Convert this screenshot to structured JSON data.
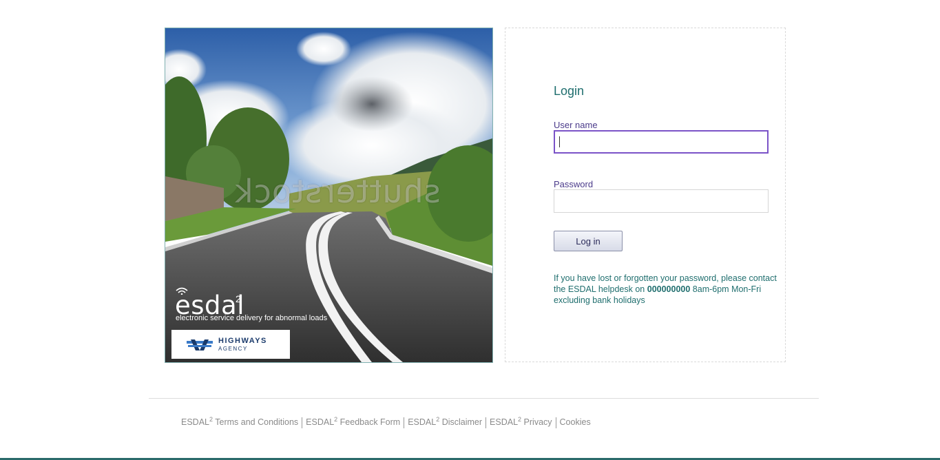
{
  "hero": {
    "watermark": "shutterstock",
    "brand_name": "esdal",
    "brand_sup": "2",
    "brand_tagline": "electronic service delivery for abnormal loads",
    "agency_name": "HIGHWAYS",
    "agency_sub": "AGENCY"
  },
  "login": {
    "title": "Login",
    "username_label": "User name",
    "username_value": "",
    "password_label": "Password",
    "password_value": "",
    "button_label": "Log in",
    "help_prefix": "If you have lost or forgotten your password, please contact the ESDAL helpdesk on ",
    "help_phone": "000000000",
    "help_suffix": " 8am-6pm Mon-Fri excluding bank holidays"
  },
  "footer": {
    "links": [
      {
        "prefix": "ESDAL",
        "sup": "2",
        "label": "Terms and Conditions"
      },
      {
        "prefix": "ESDAL",
        "sup": "2",
        "label": "Feedback Form"
      },
      {
        "prefix": "ESDAL",
        "sup": "2",
        "label": "Disclaimer"
      },
      {
        "prefix": "ESDAL",
        "sup": "2",
        "label": "Privacy"
      },
      {
        "prefix": "",
        "sup": "",
        "label": "Cookies"
      }
    ]
  },
  "colors": {
    "accent_teal": "#1f6e6e",
    "label_purple": "#4a3a8a",
    "focus_border": "#7a52c7"
  }
}
